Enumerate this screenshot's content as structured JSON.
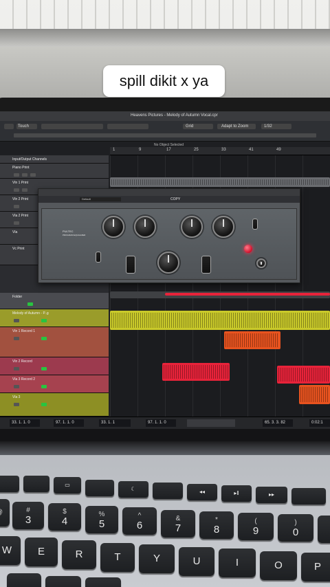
{
  "caption": "spill dikit x ya",
  "window_title": "Heavens Pictures - Melody of Autumn Vocal.cpr",
  "toolbar": {
    "mode": "Touch",
    "snap": "Grid",
    "quantize": "1/32",
    "zoom": "Adapt to Zoom"
  },
  "status": "No Object Selected",
  "ruler_marks": [
    "1",
    "9",
    "17",
    "25",
    "33",
    "41",
    "49"
  ],
  "plugin": {
    "preset": "Default",
    "copy_label": "COPY",
    "brand": "PULTEC",
    "model": "PROGRAM EQUALIZER"
  },
  "tracks": [
    {
      "name": "Input/Output Channels",
      "color": "#3a3b3f"
    },
    {
      "name": "Piano Print",
      "color": "#3a3b3f"
    },
    {
      "name": "Vln 1 Print",
      "color": "#3a3b3f"
    },
    {
      "name": "Vln 2 Print",
      "color": "#3a3b3f"
    },
    {
      "name": "Vla 2 Print",
      "color": "#3a3b3f"
    },
    {
      "name": "Vla",
      "color": "#3a3b3f"
    },
    {
      "name": "Vc Print",
      "color": "#3a3b3f"
    },
    {
      "name": "Folder",
      "color": "#4a4b50"
    },
    {
      "name": "Melody of Autumn - P..g",
      "color": "#9a9c2a"
    },
    {
      "name": "Vln 1 Record 1",
      "color": "#a2513f"
    },
    {
      "name": "Vln 2 Record",
      "color": "#9c3a4e"
    },
    {
      "name": "Vla 3 Record 2",
      "color": "#a6424f"
    },
    {
      "name": "Vla 3",
      "color": "#8d8f24"
    }
  ],
  "transport": {
    "left_locator": "33. 1. 1. 0",
    "right_locator": "97. 1. 1. 0",
    "start": "33. 1. 1",
    "end": "97. 1. 1. 0",
    "position": "65. 3. 3. 82",
    "time": "0:02:1"
  },
  "keyboard": {
    "fn_row": [
      "",
      "",
      "",
      "",
      "",
      "",
      "",
      "",
      "",
      "",
      ""
    ],
    "number_row": [
      {
        "top": "#",
        "main": "3"
      },
      {
        "top": "$",
        "main": "4"
      },
      {
        "top": "%",
        "main": "5"
      },
      {
        "top": "^",
        "main": "6"
      },
      {
        "top": "&",
        "main": "7"
      },
      {
        "top": "*",
        "main": "8"
      },
      {
        "top": "(",
        "main": "9"
      },
      {
        "top": ")",
        "main": "0"
      }
    ],
    "qwerty_row": [
      "W",
      "E",
      "R",
      "T",
      "Y",
      "U",
      "I",
      "O",
      "P"
    ],
    "left_char": "@"
  },
  "colors": {
    "clip_yellow": "#c9c92a",
    "clip_orange": "#e8531f",
    "clip_red": "#e8233a",
    "led_red": "#e0102b"
  }
}
